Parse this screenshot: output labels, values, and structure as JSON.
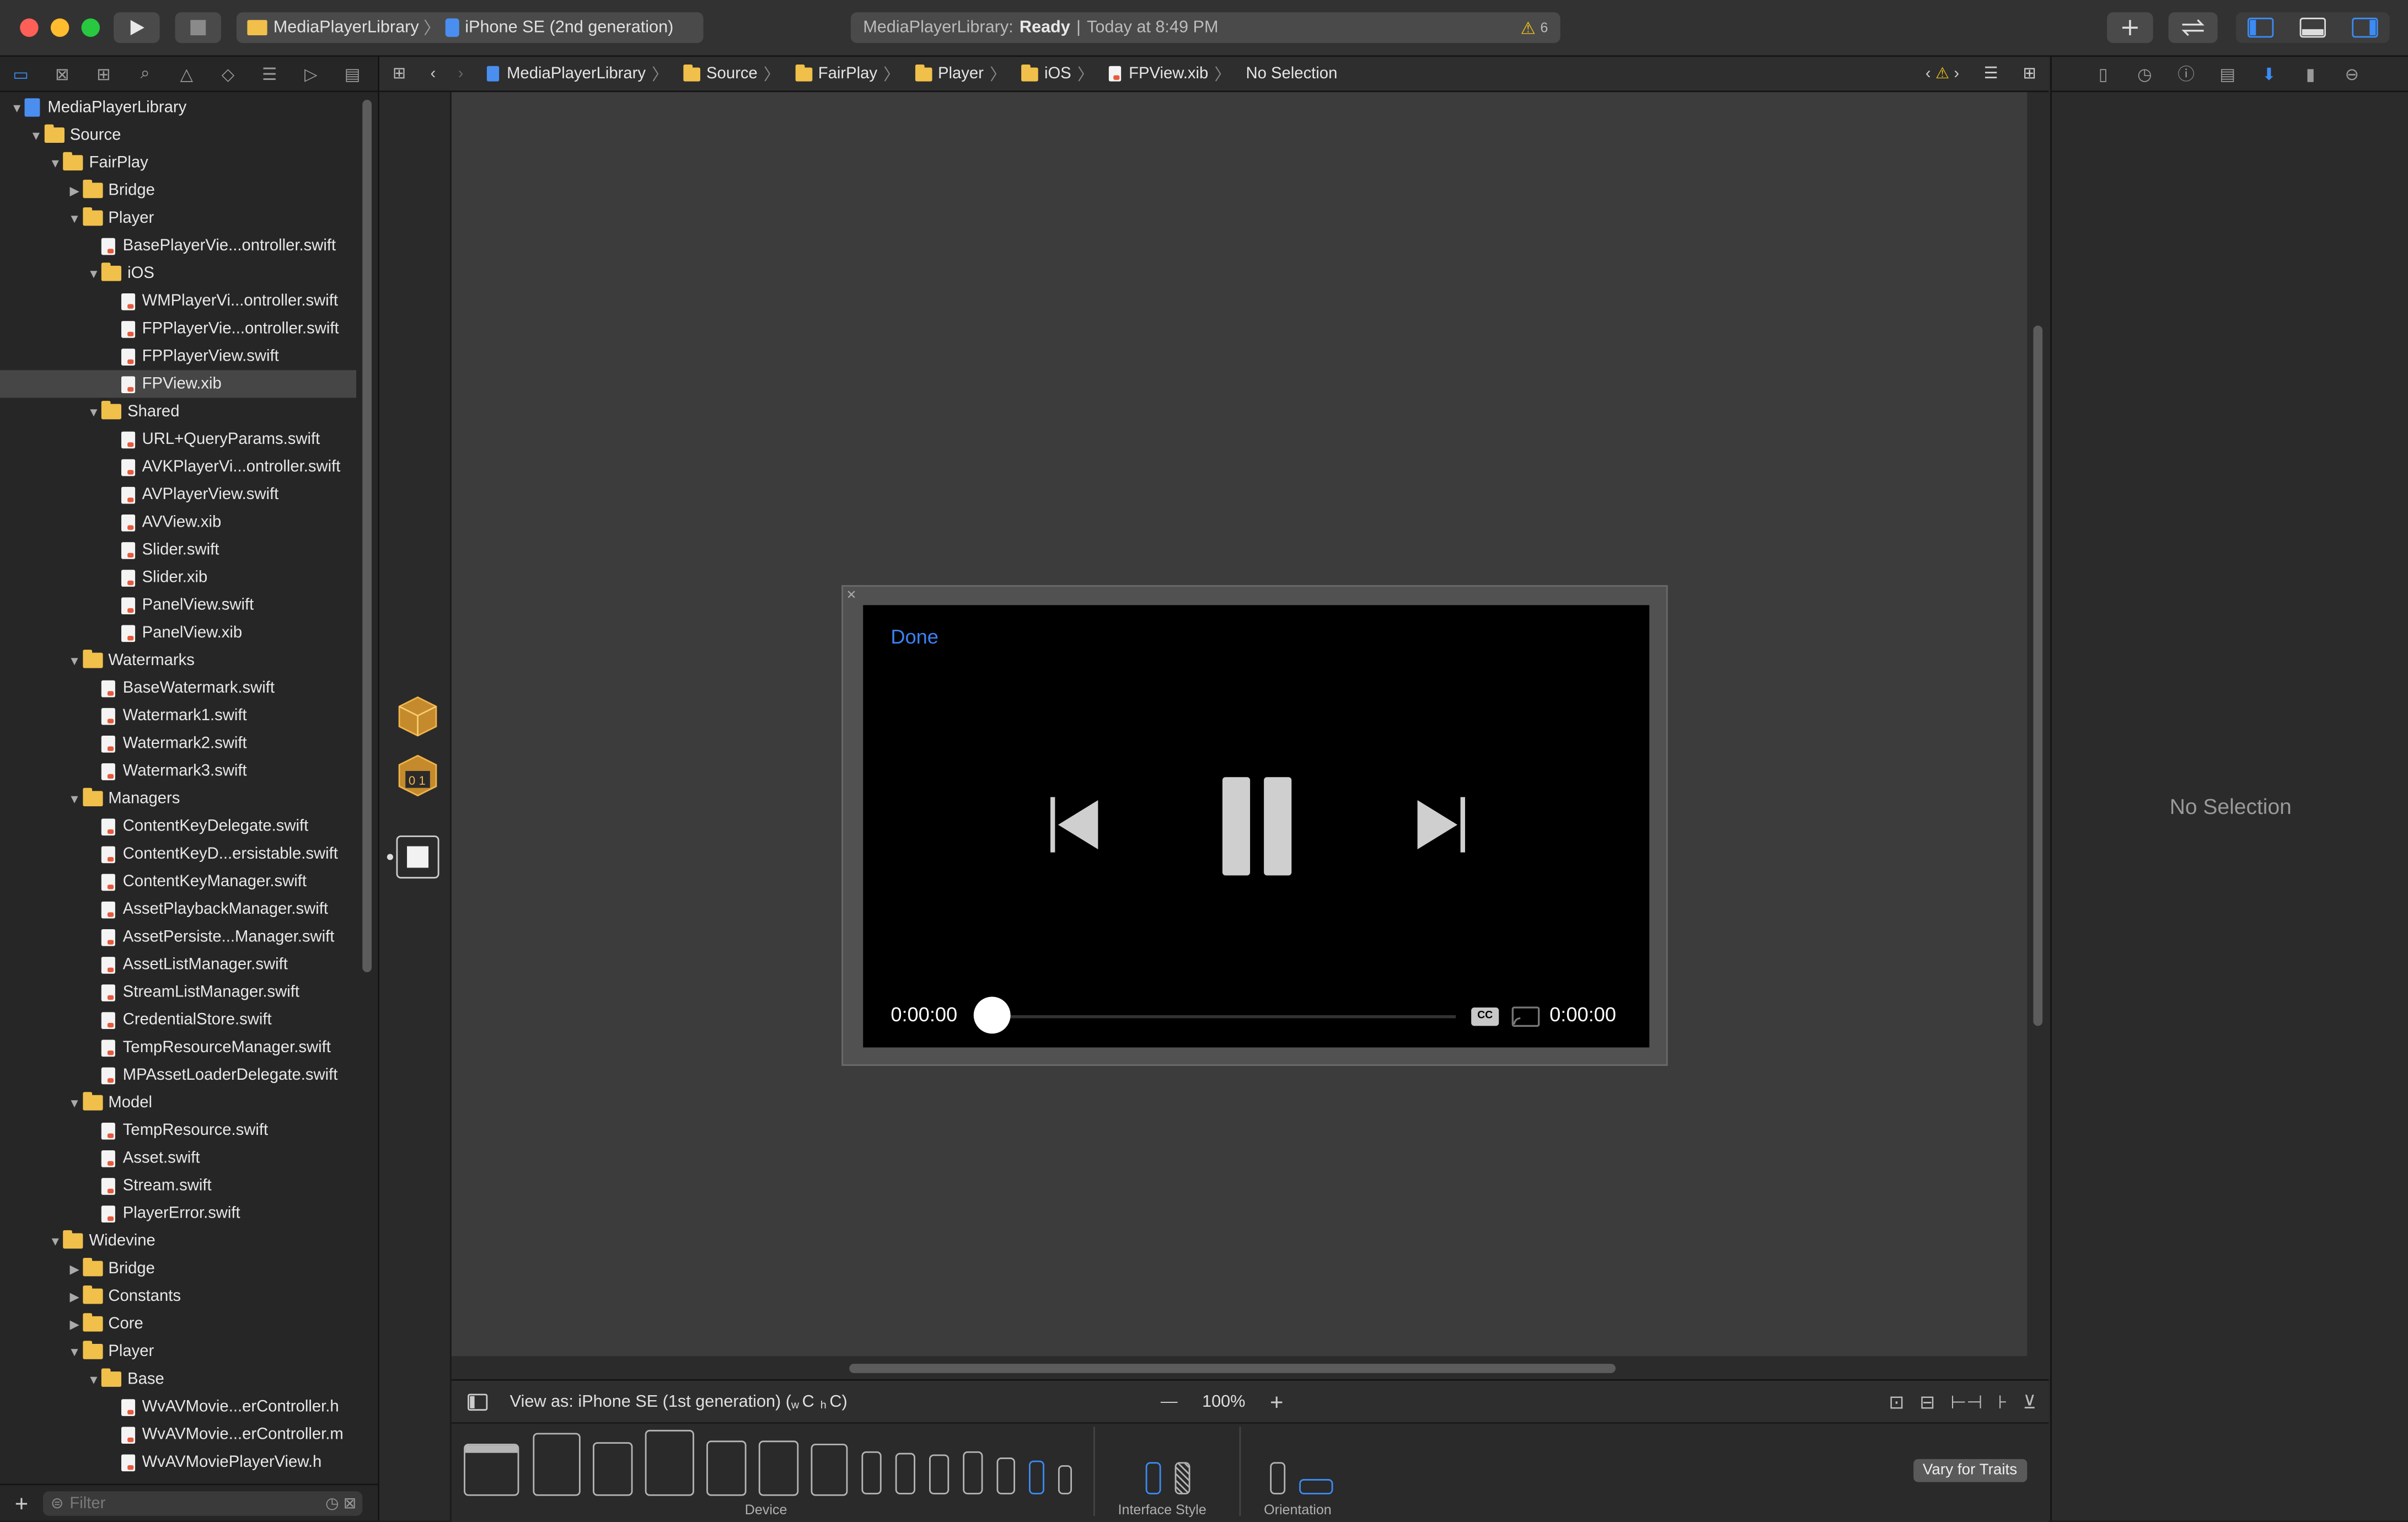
{
  "toolbar": {
    "scheme": "MediaPlayerLibrary",
    "destination": "iPhone SE (2nd generation)",
    "status_project": "MediaPlayerLibrary:",
    "status_state": "Ready",
    "status_sep": "|",
    "status_time": "Today at 8:49 PM",
    "warning_count": "6"
  },
  "navigator": {
    "filter_placeholder": "Filter",
    "rows": [
      {
        "label": "MediaPlayerLibrary",
        "depth": 0,
        "type": "project",
        "open": true
      },
      {
        "label": "Source",
        "depth": 1,
        "type": "folder",
        "open": true
      },
      {
        "label": "FairPlay",
        "depth": 2,
        "type": "folder",
        "open": true
      },
      {
        "label": "Bridge",
        "depth": 3,
        "type": "folder",
        "open": false
      },
      {
        "label": "Player",
        "depth": 3,
        "type": "folder",
        "open": true
      },
      {
        "label": "BasePlayerVie...ontroller.swift",
        "depth": 4,
        "type": "file"
      },
      {
        "label": "iOS",
        "depth": 4,
        "type": "folder",
        "open": true
      },
      {
        "label": "WMPlayerVi...ontroller.swift",
        "depth": 5,
        "type": "file"
      },
      {
        "label": "FPPlayerVie...ontroller.swift",
        "depth": 5,
        "type": "file"
      },
      {
        "label": "FPPlayerView.swift",
        "depth": 5,
        "type": "file"
      },
      {
        "label": "FPView.xib",
        "depth": 5,
        "type": "file",
        "selected": true
      },
      {
        "label": "Shared",
        "depth": 4,
        "type": "folder",
        "open": true
      },
      {
        "label": "URL+QueryParams.swift",
        "depth": 5,
        "type": "file"
      },
      {
        "label": "AVKPlayerVi...ontroller.swift",
        "depth": 5,
        "type": "file"
      },
      {
        "label": "AVPlayerView.swift",
        "depth": 5,
        "type": "file"
      },
      {
        "label": "AVView.xib",
        "depth": 5,
        "type": "file"
      },
      {
        "label": "Slider.swift",
        "depth": 5,
        "type": "file"
      },
      {
        "label": "Slider.xib",
        "depth": 5,
        "type": "file"
      },
      {
        "label": "PanelView.swift",
        "depth": 5,
        "type": "file"
      },
      {
        "label": "PanelView.xib",
        "depth": 5,
        "type": "file"
      },
      {
        "label": "Watermarks",
        "depth": 3,
        "type": "folder",
        "open": true
      },
      {
        "label": "BaseWatermark.swift",
        "depth": 4,
        "type": "file"
      },
      {
        "label": "Watermark1.swift",
        "depth": 4,
        "type": "file"
      },
      {
        "label": "Watermark2.swift",
        "depth": 4,
        "type": "file"
      },
      {
        "label": "Watermark3.swift",
        "depth": 4,
        "type": "file"
      },
      {
        "label": "Managers",
        "depth": 3,
        "type": "folder",
        "open": true
      },
      {
        "label": "ContentKeyDelegate.swift",
        "depth": 4,
        "type": "file"
      },
      {
        "label": "ContentKeyD...ersistable.swift",
        "depth": 4,
        "type": "file"
      },
      {
        "label": "ContentKeyManager.swift",
        "depth": 4,
        "type": "file"
      },
      {
        "label": "AssetPlaybackManager.swift",
        "depth": 4,
        "type": "file"
      },
      {
        "label": "AssetPersiste...Manager.swift",
        "depth": 4,
        "type": "file"
      },
      {
        "label": "AssetListManager.swift",
        "depth": 4,
        "type": "file"
      },
      {
        "label": "StreamListManager.swift",
        "depth": 4,
        "type": "file"
      },
      {
        "label": "CredentialStore.swift",
        "depth": 4,
        "type": "file"
      },
      {
        "label": "TempResourceManager.swift",
        "depth": 4,
        "type": "file"
      },
      {
        "label": "MPAssetLoaderDelegate.swift",
        "depth": 4,
        "type": "file"
      },
      {
        "label": "Model",
        "depth": 3,
        "type": "folder",
        "open": true
      },
      {
        "label": "TempResource.swift",
        "depth": 4,
        "type": "file"
      },
      {
        "label": "Asset.swift",
        "depth": 4,
        "type": "file"
      },
      {
        "label": "Stream.swift",
        "depth": 4,
        "type": "file"
      },
      {
        "label": "PlayerError.swift",
        "depth": 4,
        "type": "file"
      },
      {
        "label": "Widevine",
        "depth": 2,
        "type": "folder",
        "open": true
      },
      {
        "label": "Bridge",
        "depth": 3,
        "type": "folder",
        "open": false
      },
      {
        "label": "Constants",
        "depth": 3,
        "type": "folder",
        "open": false
      },
      {
        "label": "Core",
        "depth": 3,
        "type": "folder",
        "open": false
      },
      {
        "label": "Player",
        "depth": 3,
        "type": "folder",
        "open": true
      },
      {
        "label": "Base",
        "depth": 4,
        "type": "folder",
        "open": true
      },
      {
        "label": "WvAVMovie...erController.h",
        "depth": 5,
        "type": "file"
      },
      {
        "label": "WvAVMovie...erController.m",
        "depth": 5,
        "type": "file"
      },
      {
        "label": "WvAVMoviePlayerView.h",
        "depth": 5,
        "type": "file"
      }
    ]
  },
  "jumpbar": {
    "crumbs": [
      "MediaPlayerLibrary",
      "Source",
      "FairPlay",
      "Player",
      "iOS",
      "FPView.xib",
      "No Selection"
    ]
  },
  "player": {
    "done_label": "Done",
    "time_elapsed": "0:00:00",
    "time_total": "0:00:00",
    "progress": 0,
    "cc_label": "CC"
  },
  "canvas_bottom": {
    "view_as": "View as: iPhone SE (1st generation) (",
    "traits_w": "w",
    "traits_c1": "C",
    "traits_h": "h",
    "traits_c2": "C)",
    "zoom": "100%",
    "zoom_out": "—",
    "zoom_in": "+"
  },
  "device_bar": {
    "device_label": "Device",
    "style_label": "Interface Style",
    "orientation_label": "Orientation",
    "vary_label": "Vary for Traits"
  },
  "inspector": {
    "empty_label": "No Selection"
  },
  "colors": {
    "accent": "#3b8cf5",
    "done_blue": "#3a82f7",
    "folder": "#f0c04b",
    "warning": "#f5c518"
  }
}
